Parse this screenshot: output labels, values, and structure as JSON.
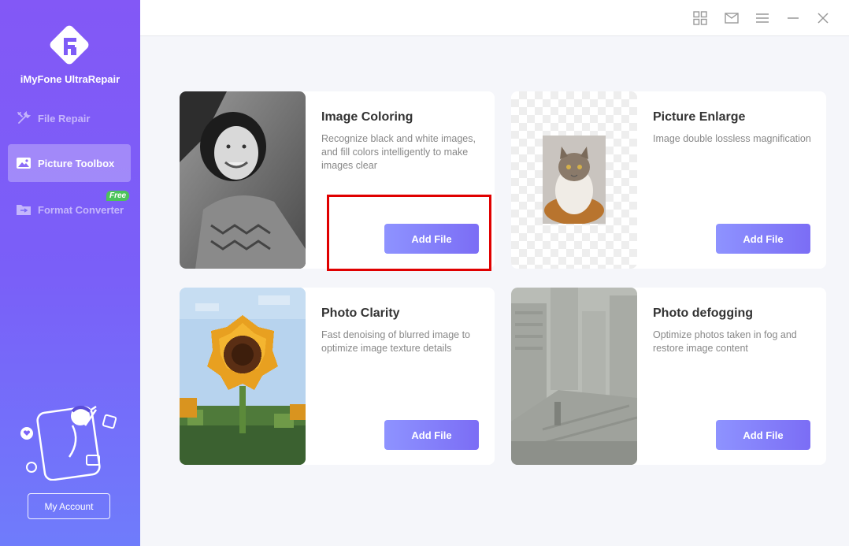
{
  "app": {
    "name": "iMyFone UltraRepair"
  },
  "sidebar": {
    "items": [
      {
        "label": "File Repair",
        "icon": "tools-icon"
      },
      {
        "label": "Picture Toolbox",
        "icon": "picture-icon"
      },
      {
        "label": "Format Converter",
        "icon": "folder-convert-icon"
      }
    ],
    "free_badge": "Free",
    "account_button": "My Account"
  },
  "topbar": {
    "icons": [
      "grid-icon",
      "mail-icon",
      "menu-icon",
      "minimize-icon",
      "close-icon"
    ]
  },
  "cards": [
    {
      "title": "Image Coloring",
      "description": "Recognize black and white images, and fill colors intelligently to make images clear",
      "button": "Add File"
    },
    {
      "title": "Picture Enlarge",
      "description": "Image double lossless magnification",
      "button": "Add File"
    },
    {
      "title": "Photo Clarity",
      "description": "Fast denoising of blurred image to optimize image texture details",
      "button": "Add File"
    },
    {
      "title": "Photo defogging",
      "description": "Optimize photos taken in fog and restore image content",
      "button": "Add File"
    }
  ],
  "colors": {
    "sidebar_top": "#8358f6",
    "sidebar_bottom": "#6f7cfb",
    "button_start": "#8e93ff",
    "button_end": "#7b6df5",
    "highlight": "#e00000",
    "free_badge": "#4cc35a"
  }
}
